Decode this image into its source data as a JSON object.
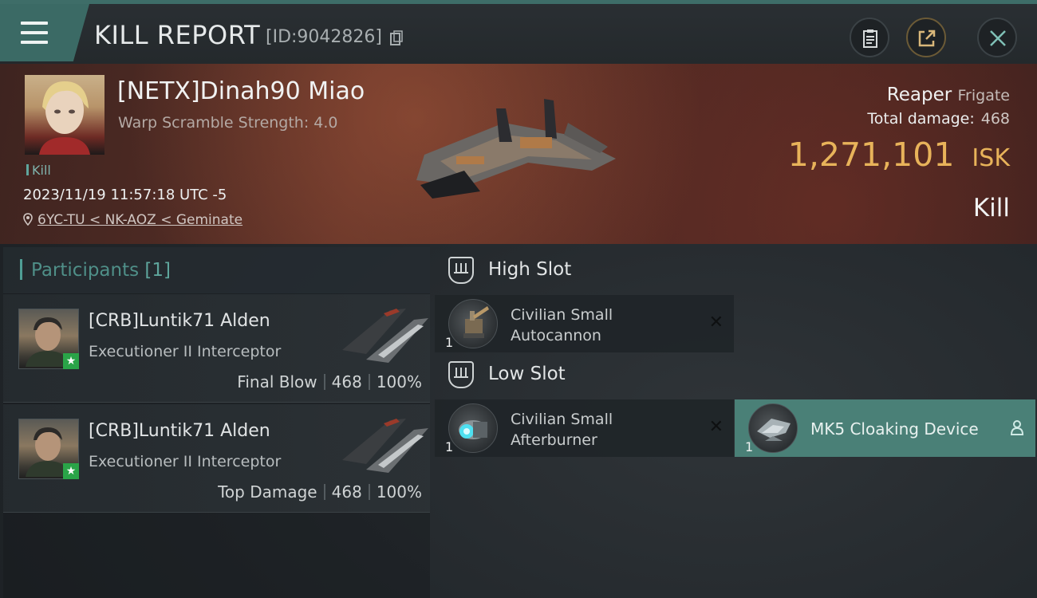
{
  "header": {
    "title": "KILL REPORT",
    "report_id": "[ID:9042826]"
  },
  "victim": {
    "name": "[NETX]Dinah90 Miao",
    "warp_scramble": "Warp Scramble Strength: 4.0",
    "tag": "Kill",
    "datetime": "2023/11/19 11:57:18 UTC -5",
    "location": "6YC-TU < NK-AOZ < Geminate",
    "ship": "Reaper",
    "ship_class": "Frigate",
    "total_damage_label": "Total damage:",
    "total_damage": "468",
    "isk_value": "1,271,101",
    "isk_unit": "ISK",
    "result": "Kill"
  },
  "participants": {
    "label": "Participants",
    "count": "[1]",
    "items": [
      {
        "name": "[CRB]Luntik71 Alden",
        "ship": "Executioner II Interceptor",
        "role": "Final Blow",
        "damage": "468",
        "percent": "100%"
      },
      {
        "name": "[CRB]Luntik71 Alden",
        "ship": "Executioner II Interceptor",
        "role": "Top Damage",
        "damage": "468",
        "percent": "100%"
      }
    ]
  },
  "fitting": {
    "high_slot_label": "High Slot",
    "low_slot_label": "Low Slot",
    "high": [
      {
        "line1": "Civilian Small",
        "line2": "Autocannon",
        "qty": "1",
        "action": "✕"
      }
    ],
    "low": [
      {
        "line1": "Civilian Small",
        "line2": "Afterburner",
        "qty": "1",
        "action": "✕"
      },
      {
        "line1": "MK5 Cloaking Device",
        "qty": "1",
        "icon": "person-icon"
      }
    ]
  },
  "colors": {
    "accent": "#4a8077",
    "isk": "#e8b35a",
    "star": "#2aa448"
  }
}
